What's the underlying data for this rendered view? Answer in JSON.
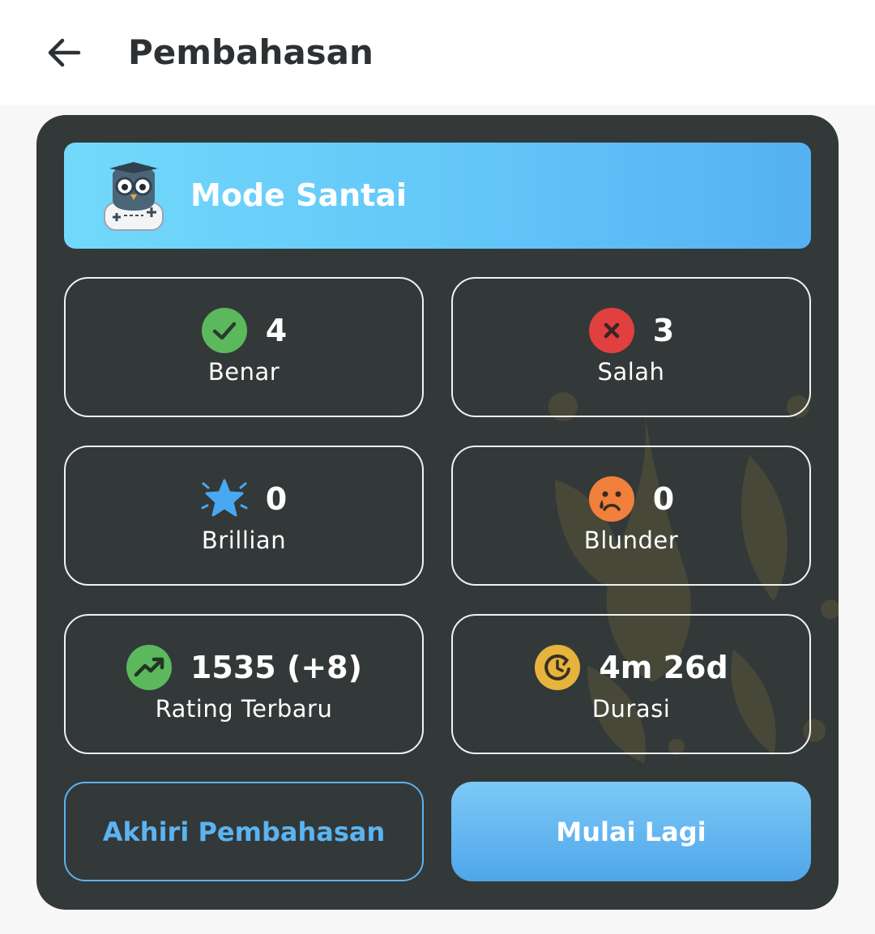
{
  "header": {
    "title": "Pembahasan"
  },
  "mode": {
    "label": "Mode Santai"
  },
  "stats": [
    {
      "value": "4",
      "label": "Benar",
      "icon": "check-circle-icon",
      "color": "#5cb85c"
    },
    {
      "value": "3",
      "label": "Salah",
      "icon": "x-circle-icon",
      "color": "#e0403f"
    },
    {
      "value": "0",
      "label": "Brillian",
      "icon": "star-icon",
      "color": "#4aa8f2"
    },
    {
      "value": "0",
      "label": "Blunder",
      "icon": "sad-face-icon",
      "color": "#f0803c"
    },
    {
      "value": "1535 (+8)",
      "label": "Rating Terbaru",
      "icon": "trending-up-icon",
      "color": "#5cb85c"
    },
    {
      "value": "4m 26d",
      "label": "Durasi",
      "icon": "clock-icon",
      "color": "#e6b33c"
    }
  ],
  "actions": {
    "end_label": "Akhiri Pembahasan",
    "restart_label": "Mulai Lagi"
  },
  "colors": {
    "card_bg": "#333839",
    "accent": "#5ab4f0"
  }
}
